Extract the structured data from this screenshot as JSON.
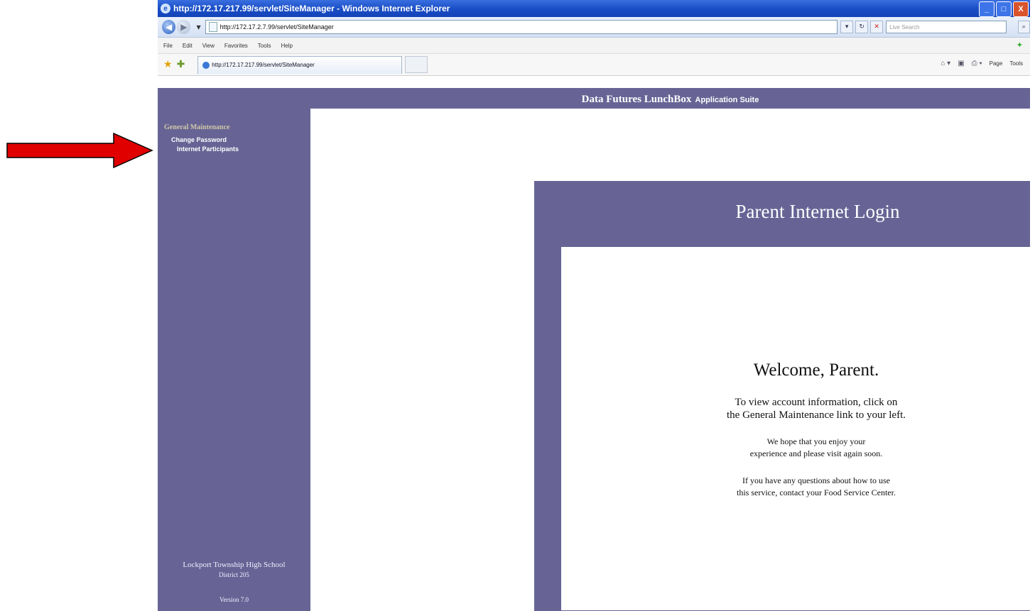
{
  "window": {
    "title": "http://172.17.217.99/servlet/SiteManager - Windows Internet Explorer",
    "minimize": "_",
    "maximize": "□",
    "close": "X"
  },
  "addressbar": {
    "url": "http://172.17.2.7.99/servlet/SiteManager",
    "search_placeholder": "Live Search"
  },
  "menu": [
    "File",
    "Edit",
    "View",
    "Favorites",
    "Tools",
    "Help"
  ],
  "tab": {
    "label": "http://172.17.217.99/servlet/SiteManager"
  },
  "commandbar": {
    "page": "Page",
    "tools": "Tools"
  },
  "app": {
    "brand": "Data Futures LunchBox",
    "suite": "Application Suite"
  },
  "sidebar": {
    "section": "General Maintenance",
    "links": [
      "Change Password",
      "Internet Participants"
    ],
    "school": "Lockport Township High School",
    "district": "District 205",
    "version": "Version 7.0"
  },
  "panel": {
    "title": "Parent Internet Login",
    "welcome": "Welcome, Parent.",
    "p1_line1": "To view account information, click on",
    "p1_line2": "the General Maintenance link to your left.",
    "p2_line1": "We hope that you enjoy your",
    "p2_line2": "experience and please visit again soon.",
    "p3_line1": "If you have any questions about how to use",
    "p3_line2": "this service, contact your Food Service Center."
  },
  "colors": {
    "panel": "#676495",
    "arrow": "#e00000",
    "titlebar": "#1a4fc7"
  },
  "icons": [
    "back-icon",
    "forward-icon",
    "refresh-icon",
    "stop-icon",
    "search-icon",
    "favorites-star-icon",
    "home-icon",
    "print-icon"
  ]
}
